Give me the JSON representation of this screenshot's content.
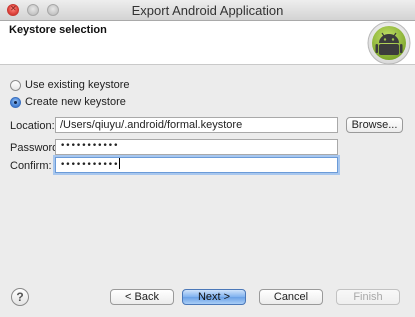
{
  "window": {
    "title": "Export Android Application"
  },
  "header": {
    "title": "Keystore selection",
    "logo_icon": "android-logo-icon"
  },
  "keystore_options": [
    {
      "label": "Use existing keystore",
      "selected": false
    },
    {
      "label": "Create new keystore",
      "selected": true
    }
  ],
  "form": {
    "location_label": "Location:",
    "location_value": "/Users/qiuyu/.android/formal.keystore",
    "browse_label": "Browse...",
    "password_label": "Password:",
    "password_value": "•••••••••••",
    "confirm_label": "Confirm:",
    "confirm_value": "•••••••••••"
  },
  "buttons": {
    "help_glyph": "?",
    "back_label": "< Back",
    "next_label": "Next >",
    "cancel_label": "Cancel",
    "finish_label": "Finish"
  }
}
